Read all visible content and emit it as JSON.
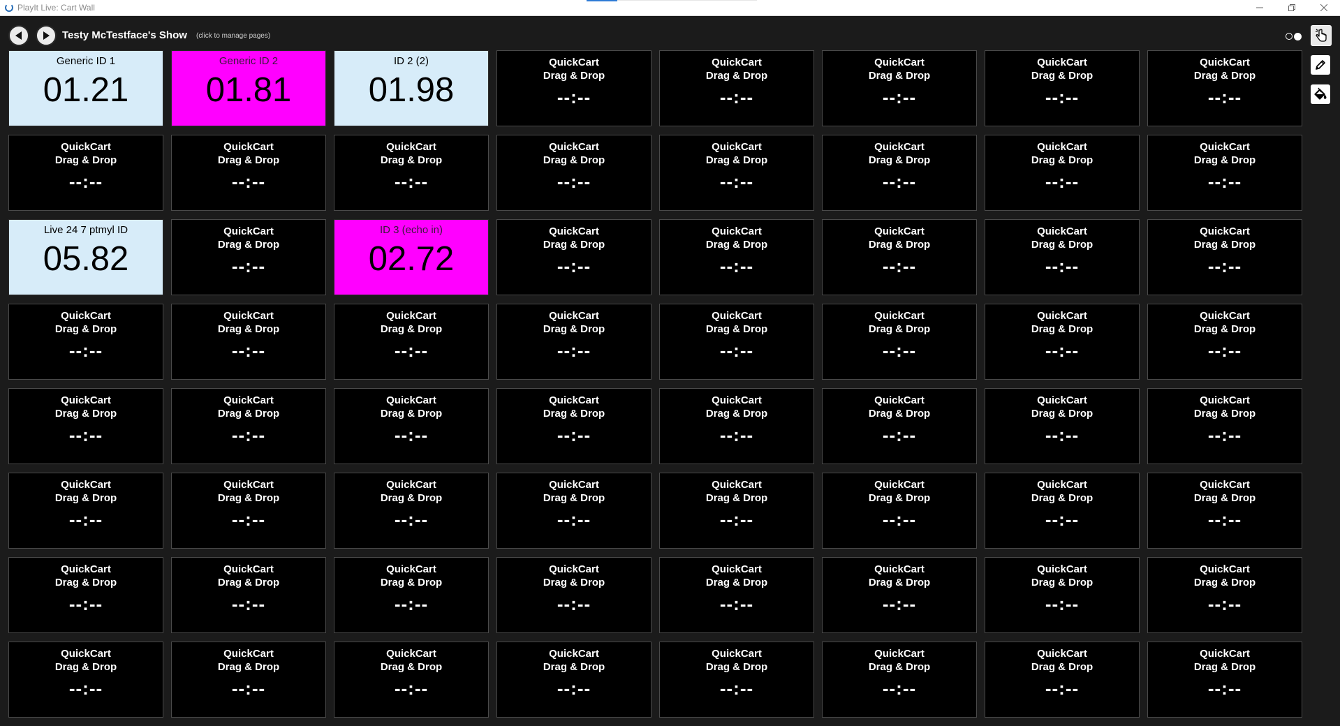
{
  "window": {
    "title": "PlayIt Live: Cart Wall"
  },
  "header": {
    "show_title": "Testy McTestface's Show",
    "hint": "(click to manage pages)"
  },
  "toolbar": {
    "tools": [
      "pointer-hand-icon",
      "pencil-icon",
      "paint-bucket-icon"
    ]
  },
  "colors": {
    "cart_blue": "#d7ecf9",
    "cart_magenta": "#ff00ff",
    "cart_empty": "#000000",
    "background": "#1b1b1b"
  },
  "empty_cart": {
    "line1": "QuickCart",
    "line2": "Drag & Drop",
    "time": "--:--"
  },
  "carts": [
    {
      "index": 0,
      "name": "Generic ID 1",
      "time": "01.21",
      "color": "blue"
    },
    {
      "index": 1,
      "name": "Generic ID 2",
      "time": "01.81",
      "color": "magenta"
    },
    {
      "index": 2,
      "name": "ID 2 (2)",
      "time": "01.98",
      "color": "blue"
    },
    {
      "index": 16,
      "name": "Live 24 7 ptmyl ID",
      "time": "05.82",
      "color": "blue"
    },
    {
      "index": 18,
      "name": "ID 3 (echo in)",
      "time": "02.72",
      "color": "magenta"
    }
  ]
}
